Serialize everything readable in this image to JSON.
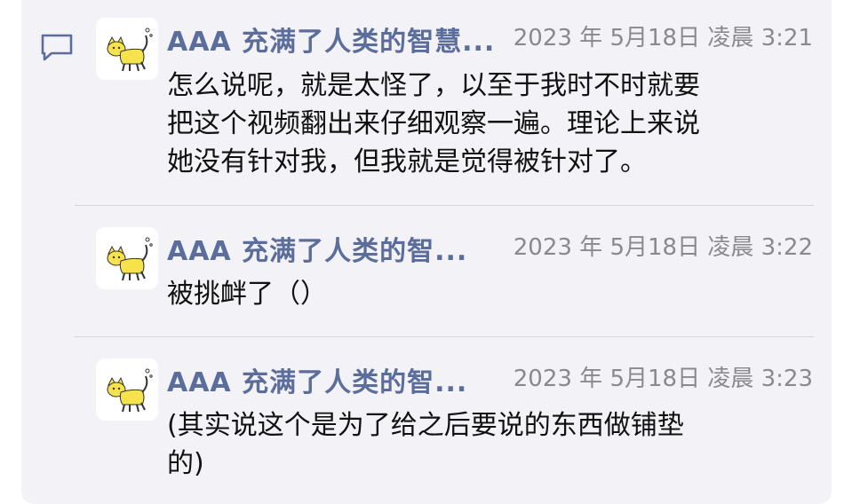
{
  "thread": {
    "messages": [
      {
        "author": "AAA 充满了人类的智慧...",
        "time": "2023 年 5月18日 凌晨 3:21",
        "lines": [
          "怎么说呢，就是太怪了，以至于我时不时就要",
          "把这个视频翻出来仔细观察一遍。理论上来说",
          "她没有针对我，但我就是觉得被针对了。"
        ]
      },
      {
        "author": "AAA 充满了人类的智...",
        "time": "2023 年 5月18日 凌晨 3:22",
        "lines": [
          "被挑衅了（）"
        ]
      },
      {
        "author": "AAA 充满了人类的智...",
        "time": "2023 年 5月18日 凌晨 3:23",
        "lines": [
          "(其实说这个是为了给之后要说的东西做铺垫",
          "的)"
        ]
      }
    ]
  },
  "colors": {
    "card_background": "#f2f2f7",
    "author_name": "#5b6d9b",
    "timestamp": "#8a8a8e",
    "comment_icon": "#5b6d9b"
  },
  "icons": {
    "comment": "speech-bubble-icon",
    "avatar": "yellow-cat-avatar"
  }
}
